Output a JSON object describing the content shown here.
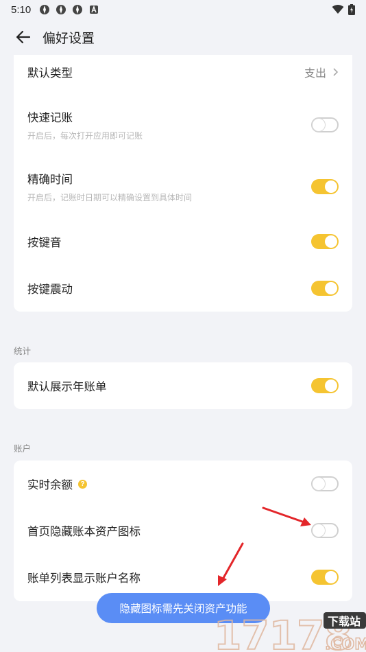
{
  "status_bar": {
    "time": "5:10",
    "icons": [
      "app-icon",
      "app-icon",
      "app-icon",
      "a-icon"
    ],
    "right_icons": [
      "wifi-icon",
      "battery-icon"
    ]
  },
  "header": {
    "title": "偏好设置",
    "back_icon": "arrow-left-icon"
  },
  "general": {
    "default_type": {
      "label": "默认类型",
      "value": "支出"
    },
    "quick_record": {
      "label": "快速记账",
      "desc": "开启后，每次打开应用即可记账",
      "enabled": false
    },
    "precise_time": {
      "label": "精确时间",
      "desc": "开启后，记账时日期可以精确设置到具体时间",
      "enabled": true
    },
    "key_sound": {
      "label": "按键音",
      "enabled": true
    },
    "key_vibration": {
      "label": "按键震动",
      "enabled": true
    }
  },
  "stats": {
    "section_label": "统计",
    "default_year_bill": {
      "label": "默认展示年账单",
      "enabled": true
    }
  },
  "account": {
    "section_label": "账户",
    "realtime_balance": {
      "label": "实时余额",
      "help_icon": "question-icon",
      "help_mark": "?",
      "enabled": false
    },
    "hide_asset_icon": {
      "label": "首页隐藏账本资产图标",
      "enabled": false
    },
    "show_account_name": {
      "label": "账单列表显示账户名称",
      "enabled": true
    }
  },
  "toast": {
    "text": "隐藏图标需先关闭资产功能"
  },
  "watermark": {
    "text": "17178",
    "badge": "下载站",
    "domain": ".COM"
  },
  "colors": {
    "accent": "#f5c431",
    "toast_bg": "#5a8df5",
    "arrow": "#e3262a",
    "background": "#f2f3f7"
  }
}
